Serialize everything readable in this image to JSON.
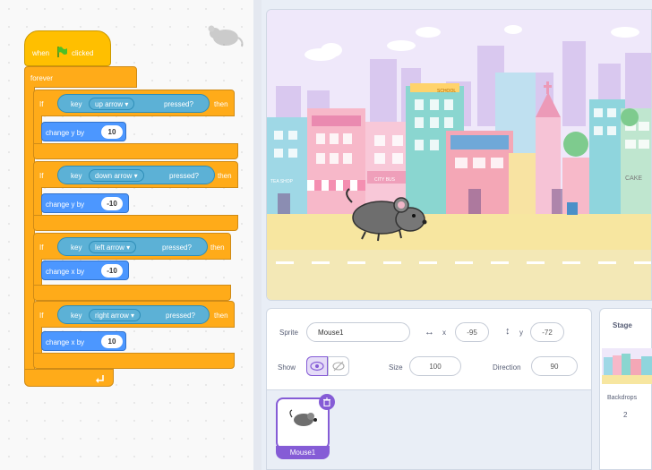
{
  "code": {
    "hat_label": "when",
    "hat_label_suffix": "clicked",
    "forever_label": "forever",
    "blocks": [
      {
        "if_label": "If",
        "key_label": "key",
        "key_value": "up arrow ▾",
        "pressed_label": "pressed?",
        "then_label": "then",
        "action_label": "change y by",
        "action_value": "10"
      },
      {
        "if_label": "If",
        "key_label": "key",
        "key_value": "down arrow ▾",
        "pressed_label": "pressed?",
        "then_label": "then",
        "action_label": "change y by",
        "action_value": "-10"
      },
      {
        "if_label": "If",
        "key_label": "key",
        "key_value": "left arrow ▾",
        "pressed_label": "pressed?",
        "then_label": "then",
        "action_label": "change x by",
        "action_value": "-10"
      },
      {
        "if_label": "If",
        "key_label": "key",
        "key_value": "right arrow ▾",
        "pressed_label": "pressed?",
        "then_label": "then",
        "action_label": "change x by",
        "action_value": "10"
      }
    ]
  },
  "sprite_info": {
    "sprite_label": "Sprite",
    "sprite_name": "Mouse1",
    "x_label": "x",
    "x_value": "-95",
    "y_label": "y",
    "y_value": "-72",
    "show_label": "Show",
    "size_label": "Size",
    "size_value": "100",
    "direction_label": "Direction",
    "direction_value": "90"
  },
  "sprite_list": {
    "items": [
      {
        "name": "Mouse1"
      }
    ]
  },
  "stage_panel": {
    "title": "Stage",
    "backdrops_label": "Backdrops",
    "backdrops_count": "2"
  },
  "stage": {
    "signs": {
      "sign1": "SCHOOL",
      "sign2": "CITY BUS",
      "sign3": "TEA SHOP",
      "sign4": "CAKE"
    }
  },
  "colors": {
    "control": "#ffab19",
    "events": "#ffbf00",
    "motion": "#4c97ff",
    "sensing": "#5cb1d6",
    "selected": "#855cd6"
  }
}
